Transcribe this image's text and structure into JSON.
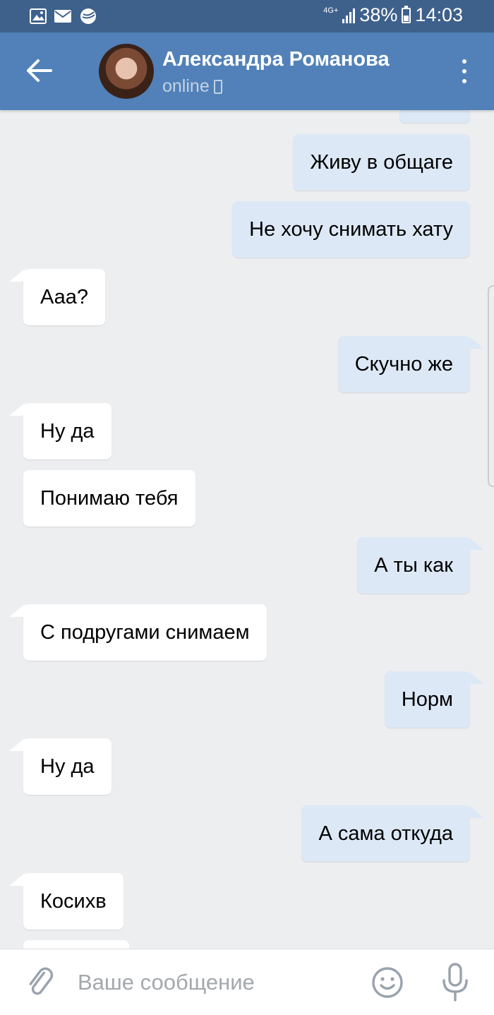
{
  "status_bar": {
    "network": "4G+",
    "battery": "38%",
    "time": "14:03",
    "icons": [
      "image-icon",
      "mail-icon",
      "sberbank-icon"
    ]
  },
  "header": {
    "contact_name": "Александра Романова",
    "status": "online"
  },
  "messages": [
    {
      "side": "out",
      "text": "Живу в общаге"
    },
    {
      "side": "out",
      "text": "Не хочу снимать хату"
    },
    {
      "side": "in",
      "text": "Ааа?"
    },
    {
      "side": "out",
      "text": "Скучно же"
    },
    {
      "side": "in",
      "text": "Ну да"
    },
    {
      "side": "in",
      "text": "Понимаю тебя"
    },
    {
      "side": "out",
      "text": "А ты как"
    },
    {
      "side": "in",
      "text": "С подругами снимаем"
    },
    {
      "side": "out",
      "text": "Норм"
    },
    {
      "side": "in",
      "text": "Ну да"
    },
    {
      "side": "out",
      "text": "А сама откуда"
    },
    {
      "side": "in",
      "text": "Косихв"
    }
  ],
  "composer": {
    "placeholder": "Ваше сообщение"
  },
  "colors": {
    "header": "#5181b8",
    "status_bar": "#3e618c",
    "chat_background": "#edeef0",
    "outgoing_bubble": "#dde8f6",
    "incoming_bubble": "#ffffff"
  }
}
